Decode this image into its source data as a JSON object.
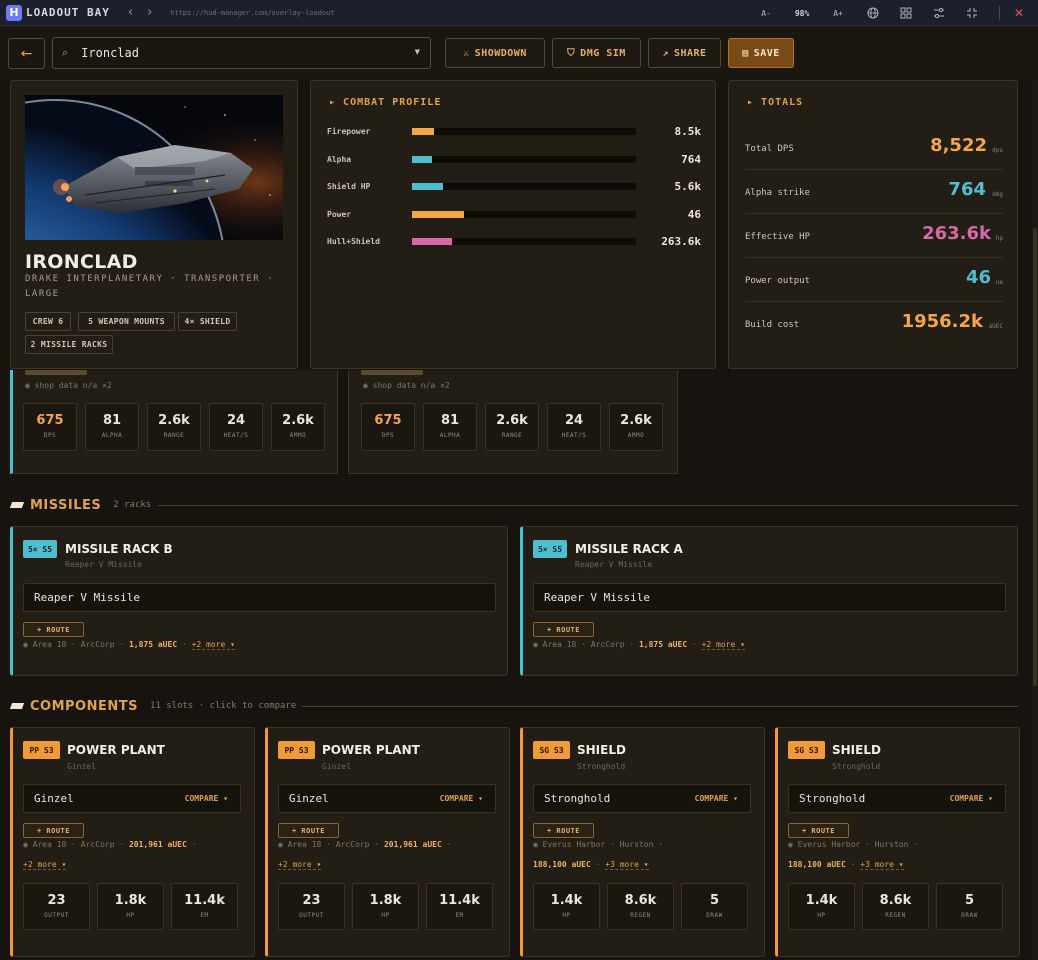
{
  "titlebar": {
    "app_name": "LOADOUT BAY",
    "logo_letter": "H",
    "back_glyph": "‹",
    "forward_glyph": "›",
    "url": "https://hud-manager.com/overlay-loadout",
    "zoom_out": "A-",
    "zoom_level": "98%",
    "zoom_in": "A+",
    "icons": [
      "globe-icon",
      "grid-icon",
      "sliders-icon",
      "compress-icon",
      "close-icon"
    ]
  },
  "toolbar": {
    "back_glyph": "←",
    "search_value": "Ironclad",
    "showdown_label": "SHOWDOWN",
    "dmg_sim_label": "DMG SIM",
    "share_label": "SHARE",
    "save_label": "SAVE"
  },
  "ship": {
    "name": "IRONCLAD",
    "subtitle": "DRAKE INTERPLANETARY · TRANSPORTER · LARGE",
    "chips": [
      "CREW 6",
      "5 WEAPON MOUNTS",
      "4× SHIELD",
      "2 MISSILE RACKS"
    ]
  },
  "combat_profile": {
    "title": "COMBAT PROFILE",
    "rows": [
      {
        "label": "Firepower",
        "value": "8.5k",
        "fill": 0.1,
        "color": "#f5a54a"
      },
      {
        "label": "Alpha",
        "value": "764",
        "fill": 0.09,
        "color": "#4fbfd0"
      },
      {
        "label": "Shield HP",
        "value": "5.6k",
        "fill": 0.14,
        "color": "#4fbfd0"
      },
      {
        "label": "Power",
        "value": "46",
        "fill": 0.23,
        "color": "#f5a54a"
      },
      {
        "label": "Hull+Shield",
        "value": "263.6k",
        "fill": 0.18,
        "color": "#d66aa8"
      }
    ]
  },
  "totals": {
    "title": "TOTALS",
    "rows": [
      {
        "label": "Total DPS",
        "value": "8,522",
        "unit": "dps",
        "color": "#f5a54a"
      },
      {
        "label": "Alpha strike",
        "value": "764",
        "unit": "dmg",
        "color": "#4fbfd0"
      },
      {
        "label": "Effective HP",
        "value": "263.6k",
        "unit": "hp",
        "color": "#d66aa8"
      },
      {
        "label": "Power output",
        "value": "46",
        "unit": "ue",
        "color": "#4fbfd0"
      },
      {
        "label": "Build cost",
        "value": "1956.2k",
        "unit": "aUEC",
        "color": "#f5a54a"
      }
    ]
  },
  "weapons": [
    {
      "shop": "◉ shop data n/a ×2",
      "stats": [
        {
          "value": "675",
          "label": "DPS",
          "accent": true
        },
        {
          "value": "81",
          "label": "ALPHA"
        },
        {
          "value": "2.6k",
          "label": "RANGE"
        },
        {
          "value": "24",
          "label": "HEAT/S"
        },
        {
          "value": "2.6k",
          "label": "AMMO"
        }
      ]
    },
    {
      "shop": "◉ shop data n/a ×2",
      "stats": [
        {
          "value": "675",
          "label": "DPS",
          "accent": true
        },
        {
          "value": "81",
          "label": "ALPHA"
        },
        {
          "value": "2.6k",
          "label": "RANGE"
        },
        {
          "value": "24",
          "label": "HEAT/S"
        },
        {
          "value": "2.6k",
          "label": "AMMO"
        }
      ]
    }
  ],
  "missiles": {
    "title": "MISSILES",
    "count": "2 racks",
    "cards": [
      {
        "badge": "5× S5",
        "title": "MISSILE RACK B",
        "sub": "Reaper V Missile",
        "selected": "Reaper V Missile",
        "route": "+ ROUTE",
        "loc": "◉ Area 18 · ArcCorp · ",
        "price": "1,875 aUEC",
        "more": "+2 more ▾"
      },
      {
        "badge": "5× S5",
        "title": "MISSILE RACK A",
        "sub": "Reaper V Missile",
        "selected": "Reaper V Missile",
        "route": "+ ROUTE",
        "loc": "◉ Area 18 · ArcCorp · ",
        "price": "1,875 aUEC",
        "more": "+2 more ▾"
      }
    ]
  },
  "components": {
    "title": "COMPONENTS",
    "count": "11 slots · click to compare",
    "cards": [
      {
        "badge": "PP S3",
        "title": "POWER PLANT",
        "sub": "Ginzel",
        "selected": "Ginzel",
        "compare": "COMPARE ▾",
        "route": "+ ROUTE",
        "loc": "◉ Area 18 · ArcCorp · ",
        "price": "201,961 aUEC",
        "loc_tail": " ·",
        "more": "+2 more ▾",
        "stats": [
          {
            "value": "23",
            "label": "OUTPUT"
          },
          {
            "value": "1.8k",
            "label": "HP"
          },
          {
            "value": "11.4k",
            "label": "EM"
          }
        ]
      },
      {
        "badge": "PP S3",
        "title": "POWER PLANT",
        "sub": "Ginzel",
        "selected": "Ginzel",
        "compare": "COMPARE ▾",
        "route": "+ ROUTE",
        "loc": "◉ Area 18 · ArcCorp · ",
        "price": "201,961 aUEC",
        "loc_tail": " ·",
        "more": "+2 more ▾",
        "stats": [
          {
            "value": "23",
            "label": "OUTPUT"
          },
          {
            "value": "1.8k",
            "label": "HP"
          },
          {
            "value": "11.4k",
            "label": "EM"
          }
        ]
      },
      {
        "badge": "SG S3",
        "title": "SHIELD",
        "sub": "Stronghold",
        "selected": "Stronghold",
        "compare": "COMPARE ▾",
        "route": "+ ROUTE",
        "loc": "◉ Everus Harbor · Hurston ·",
        "price": "188,100 aUEC",
        "loc_tail": " · ",
        "more": "+3 more ▾",
        "stats": [
          {
            "value": "1.4k",
            "label": "HP"
          },
          {
            "value": "8.6k",
            "label": "REGEN"
          },
          {
            "value": "5",
            "label": "DRAW"
          }
        ]
      },
      {
        "badge": "SG S3",
        "title": "SHIELD",
        "sub": "Stronghold",
        "selected": "Stronghold",
        "compare": "COMPARE ▾",
        "route": "+ ROUTE",
        "loc": "◉ Everus Harbor · Hurston ·",
        "price": "188,100 aUEC",
        "loc_tail": " · ",
        "more": "+3 more ▾",
        "stats": [
          {
            "value": "1.4k",
            "label": "HP"
          },
          {
            "value": "8.6k",
            "label": "REGEN"
          },
          {
            "value": "5",
            "label": "DRAW"
          }
        ]
      }
    ]
  }
}
